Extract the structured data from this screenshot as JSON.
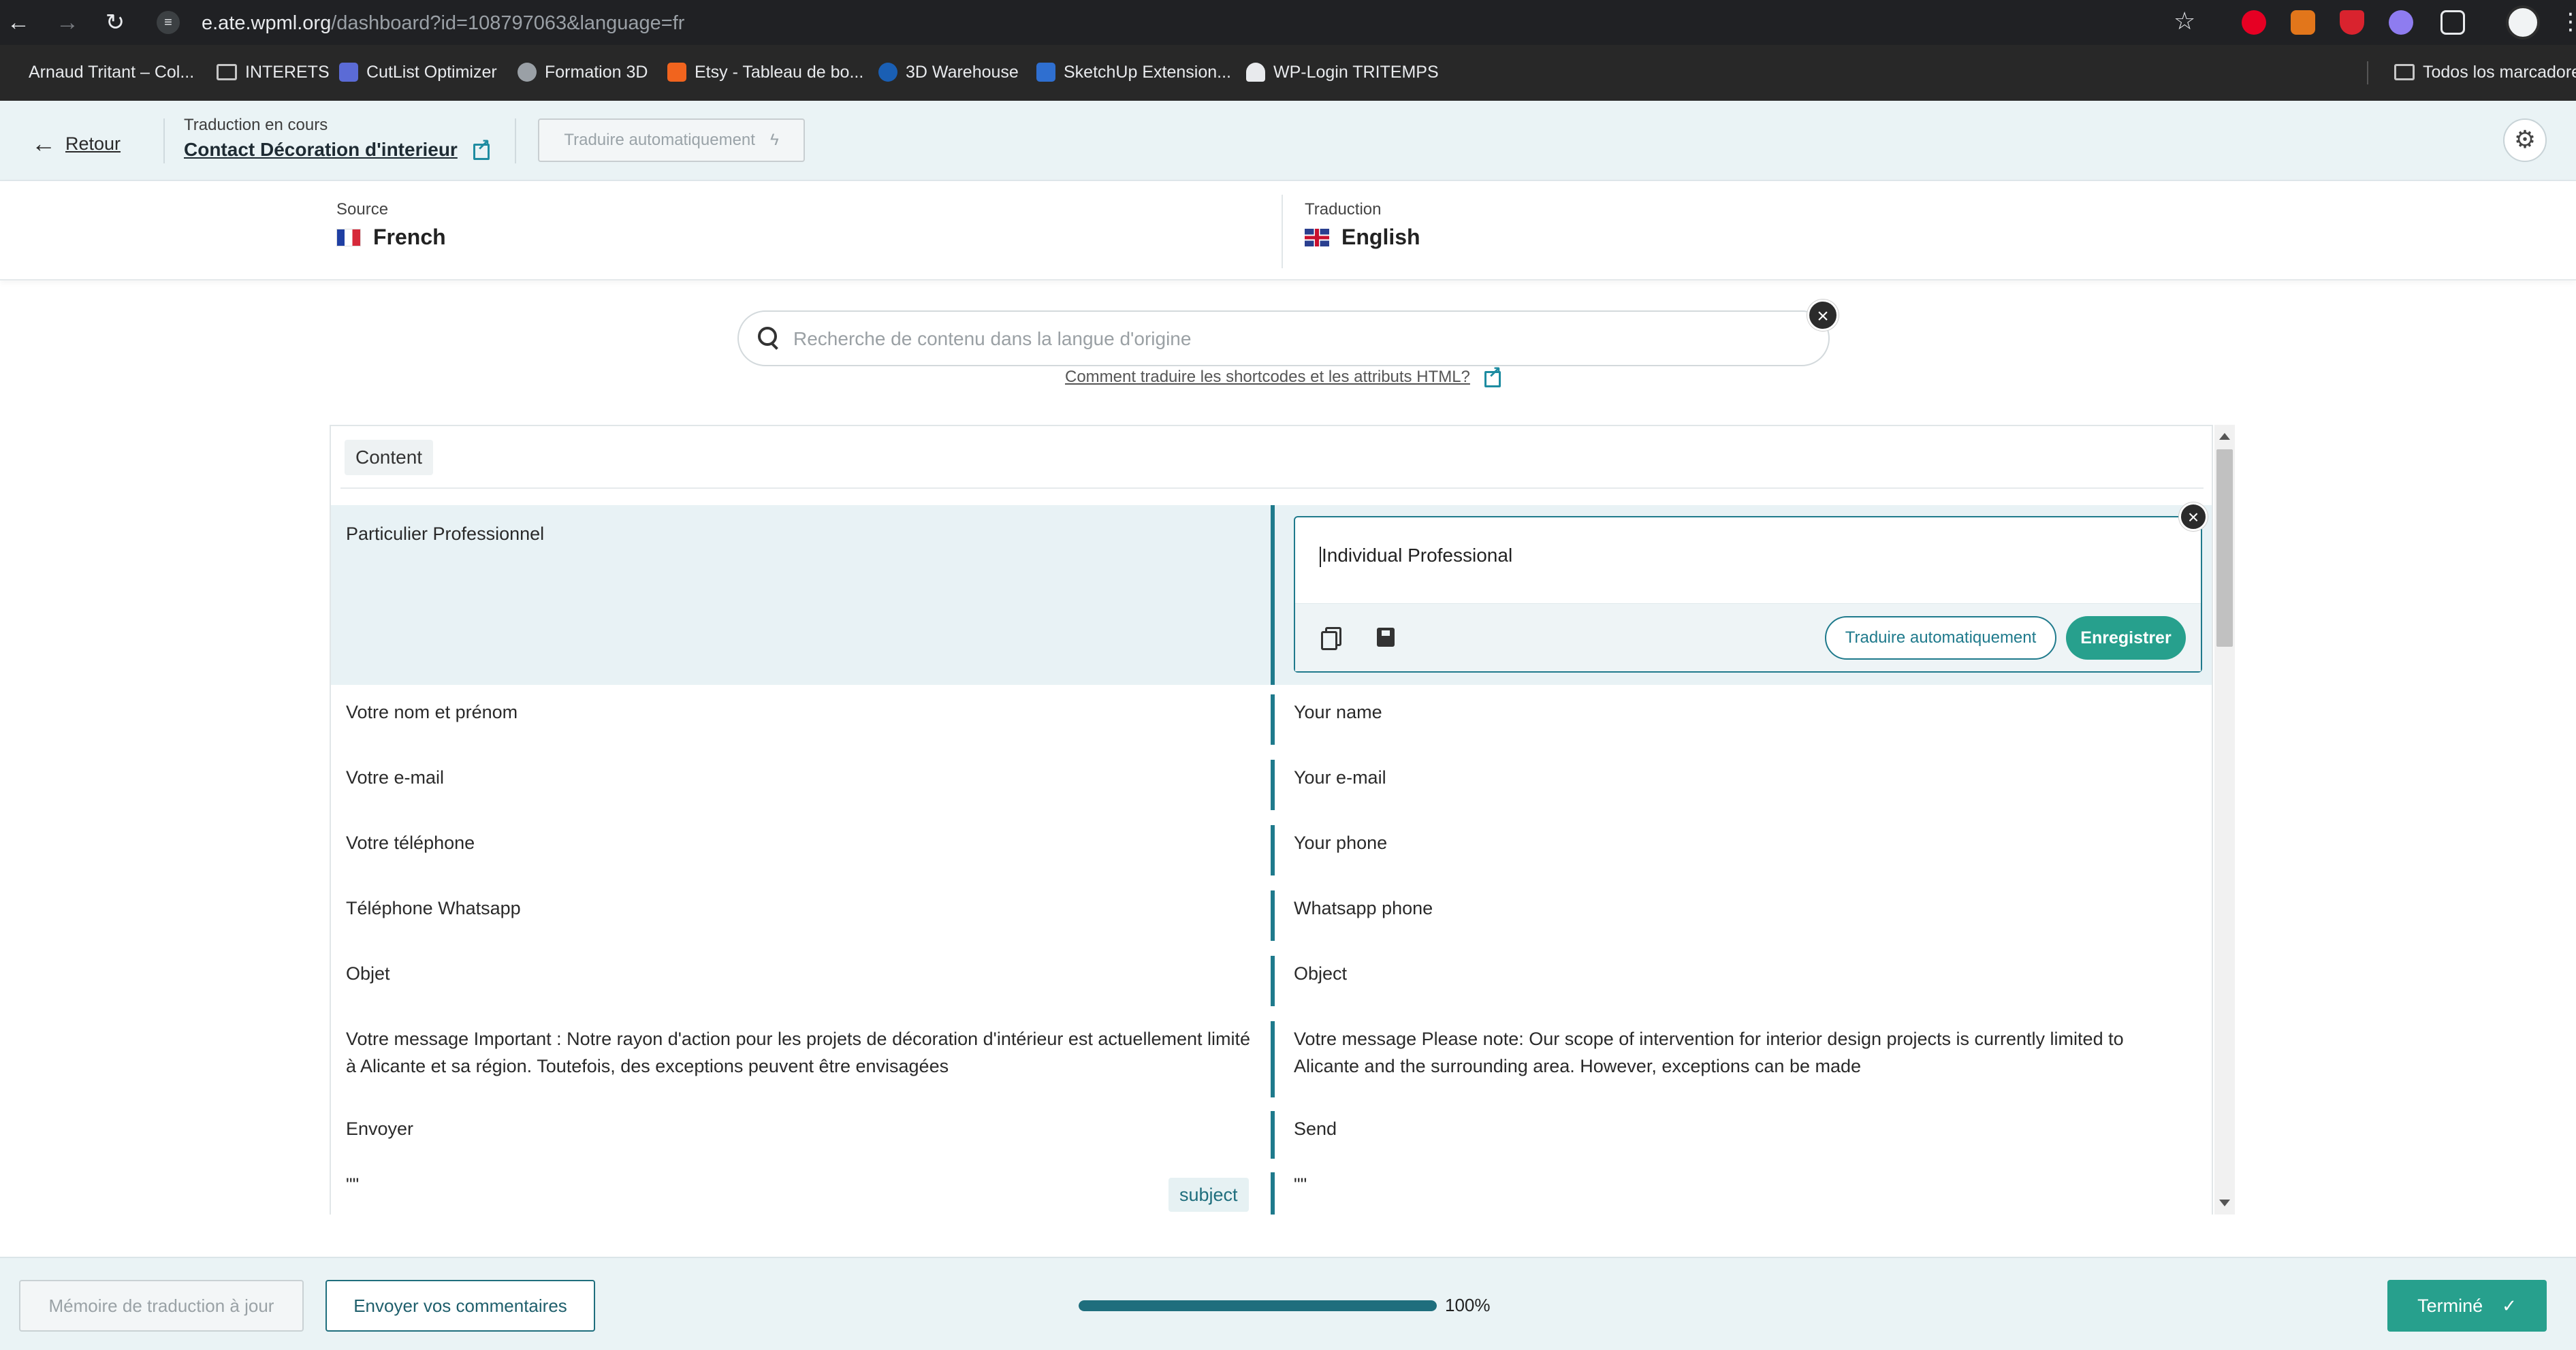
{
  "browser": {
    "url_host": "e.ate.wpml.org",
    "url_path": "/dashboard?id=108797063&language=fr",
    "bookmarks": [
      {
        "label": "Arnaud Tritant – Col..."
      },
      {
        "label": "INTERETS"
      },
      {
        "label": "CutList Optimizer"
      },
      {
        "label": "Formation 3D"
      },
      {
        "label": "Etsy - Tableau de bo..."
      },
      {
        "label": "3D Warehouse"
      },
      {
        "label": "SketchUp Extension..."
      },
      {
        "label": "WP-Login TRITEMPS"
      },
      {
        "label": "Todos los marcadores"
      }
    ]
  },
  "header": {
    "back_label": "Retour",
    "status": "Traduction en cours",
    "doc_title": "Contact Décoration d'interieur",
    "auto_translate_label": "Traduire automatiquement"
  },
  "languages": {
    "source_label": "Source",
    "source_name": "French",
    "target_label": "Traduction",
    "target_name": "English"
  },
  "search": {
    "placeholder": "Recherche de contenu dans la langue d'origine",
    "help_link": "Comment traduire les shortcodes et les attributs HTML?"
  },
  "section_tab": "Content",
  "editor": {
    "value": "Individual Professional",
    "auto_translate_label": "Traduire automatiquement",
    "save_label": "Enregistrer"
  },
  "rows": [
    {
      "source": "Particulier Professionnel",
      "target": "Individual Professional"
    },
    {
      "source": "Votre nom et prénom",
      "target": "Your name"
    },
    {
      "source": "Votre e-mail",
      "target": "Your e-mail"
    },
    {
      "source": "Votre téléphone",
      "target": "Your phone"
    },
    {
      "source": "Téléphone Whatsapp",
      "target": "Whatsapp phone"
    },
    {
      "source": "Objet",
      "target": "Object"
    },
    {
      "source": "Votre message Important : Notre rayon d'action pour les projets de décoration d'intérieur est actuellement limité à Alicante et sa région. Toutefois, des exceptions peuvent être envisagées",
      "target": "Votre message Please note: Our scope of intervention for interior design projects is currently limited to Alicante and the surrounding area. However, exceptions can be made"
    },
    {
      "source": "Envoyer",
      "target": "Send"
    },
    {
      "source": "\"\"",
      "target": "\"\"",
      "tag": "subject"
    }
  ],
  "footer": {
    "memory_label": "Mémoire de traduction à jour",
    "feedback_label": "Envoyer vos commentaires",
    "progress": 100,
    "progress_text": "100%",
    "done_label": "Terminé"
  },
  "colors": {
    "accent": "#1f7a8c",
    "primary_button": "#27a08d",
    "header_bg": "#eaf3f5"
  }
}
